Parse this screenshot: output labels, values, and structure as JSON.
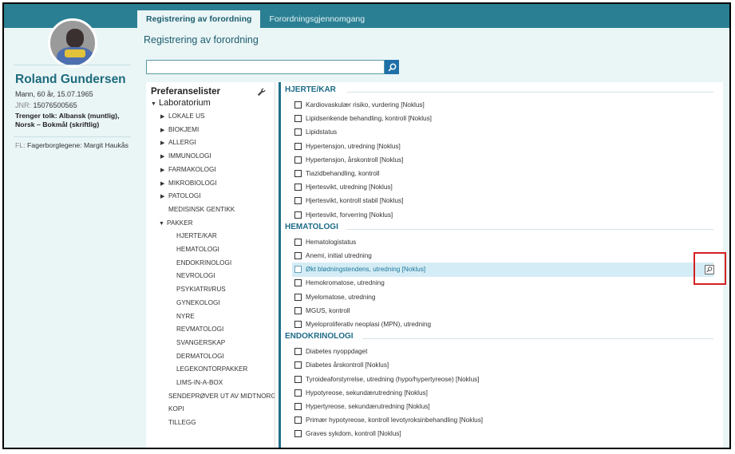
{
  "tabs": [
    {
      "label": "Registrering av forordning",
      "active": true
    },
    {
      "label": "Forordningsgjennomgang",
      "active": false
    }
  ],
  "page": {
    "title": "Registrering av forordning"
  },
  "search": {
    "value": "",
    "placeholder": ""
  },
  "patient": {
    "name": "Roland Gundersen",
    "gender_age": "Mann, 60 år, 15.07.1965",
    "jnr_label": "JNR:",
    "jnr_value": "15076500565",
    "interpreter": "Trenger tolk: Albansk (muntlig), Norsk – Bokmål (skriftlig)",
    "fl_label": "FL:",
    "fl_value": "Fagerborglegene: Margit Haukås"
  },
  "preferences": {
    "title": "Preferanselister",
    "root": "Laboratorium",
    "items": [
      {
        "label": "LOKALE US",
        "caret": "right"
      },
      {
        "label": "BIOKJEMI",
        "caret": "right"
      },
      {
        "label": "ALLERGI",
        "caret": "right"
      },
      {
        "label": "IMMUNOLOGI",
        "caret": "right"
      },
      {
        "label": "FARMAKOLOGI",
        "caret": "right"
      },
      {
        "label": "MIKROBIOLOGI",
        "caret": "right"
      },
      {
        "label": "PATOLOGI",
        "caret": "right"
      },
      {
        "label": "MEDISINSK GENTIKK",
        "caret": "none"
      },
      {
        "label": "PAKKER",
        "caret": "down"
      }
    ],
    "packages": [
      "HJERTE/KAR",
      "HEMATOLOGI",
      "ENDOKRINOLOGI",
      "NEVROLOGI",
      "PSYKIATRI/RUS",
      "GYNEKOLOGI",
      "NYRE",
      "REVMATOLOGI",
      "SVANGERSKAP",
      "DERMATOLOGI",
      "LEGEKONTORPAKKER",
      "LIMS-IN-A-BOX"
    ],
    "bottom": [
      "SENDEPRØVER UT AV MIDTNORGE",
      "KOPI",
      "TILLEGG"
    ]
  },
  "categories": [
    {
      "title": "HJERTE/KAR",
      "items": [
        "Kardiovaskulær risiko, vurdering [Noklus]",
        "Lipidsenkende behandling, kontroll [Noklus]",
        "Lipidstatus",
        "Hypertensjon, utredning [Noklus]",
        "Hypertensjon, årskontroll [Noklus]",
        "Tiazidbehandling, kontroll",
        "Hjertesvikt, utredning [Noklus]",
        "Hjertesvikt, kontroll stabil [Noklus]",
        "Hjertesvikt, forverring [Noklus]"
      ]
    },
    {
      "title": "HEMATOLOGI",
      "items": [
        "Hematologistatus",
        "Anemi, initial utredning",
        "Økt blødningstendens, utredning [Noklus]",
        "Hemokromatose, utredning",
        "Myelomatose, utredning",
        "MGUS, kontroll",
        "Myeloproliferativ neoplasi (MPN), utredning"
      ]
    },
    {
      "title": "ENDOKRINOLOGI",
      "items": [
        "Diabetes nyoppdaget",
        "Diabetes årskontroll [Noklus]",
        "Tyroideaforstyrrelse, utredning (hypo/hypertyreose) [Noklus]",
        "Hypotyreose, sekundærutredning [Noklus]",
        "Hypertyreose, sekundærutredning [Noklus]",
        "Primær hypotyreose, kontroll levotyroksinbehandling [Noklus]",
        "Graves sykdom, kontroll [Noklus]"
      ]
    }
  ],
  "highlight": {
    "category": 1,
    "item": 2
  },
  "colors": {
    "header_teal": "#2a7f93",
    "panel_bg": "#eaf5f6",
    "accent_blue": "#1d6b88",
    "highlight_bg": "#d4ecf5",
    "annotation_red": "#d62020"
  }
}
